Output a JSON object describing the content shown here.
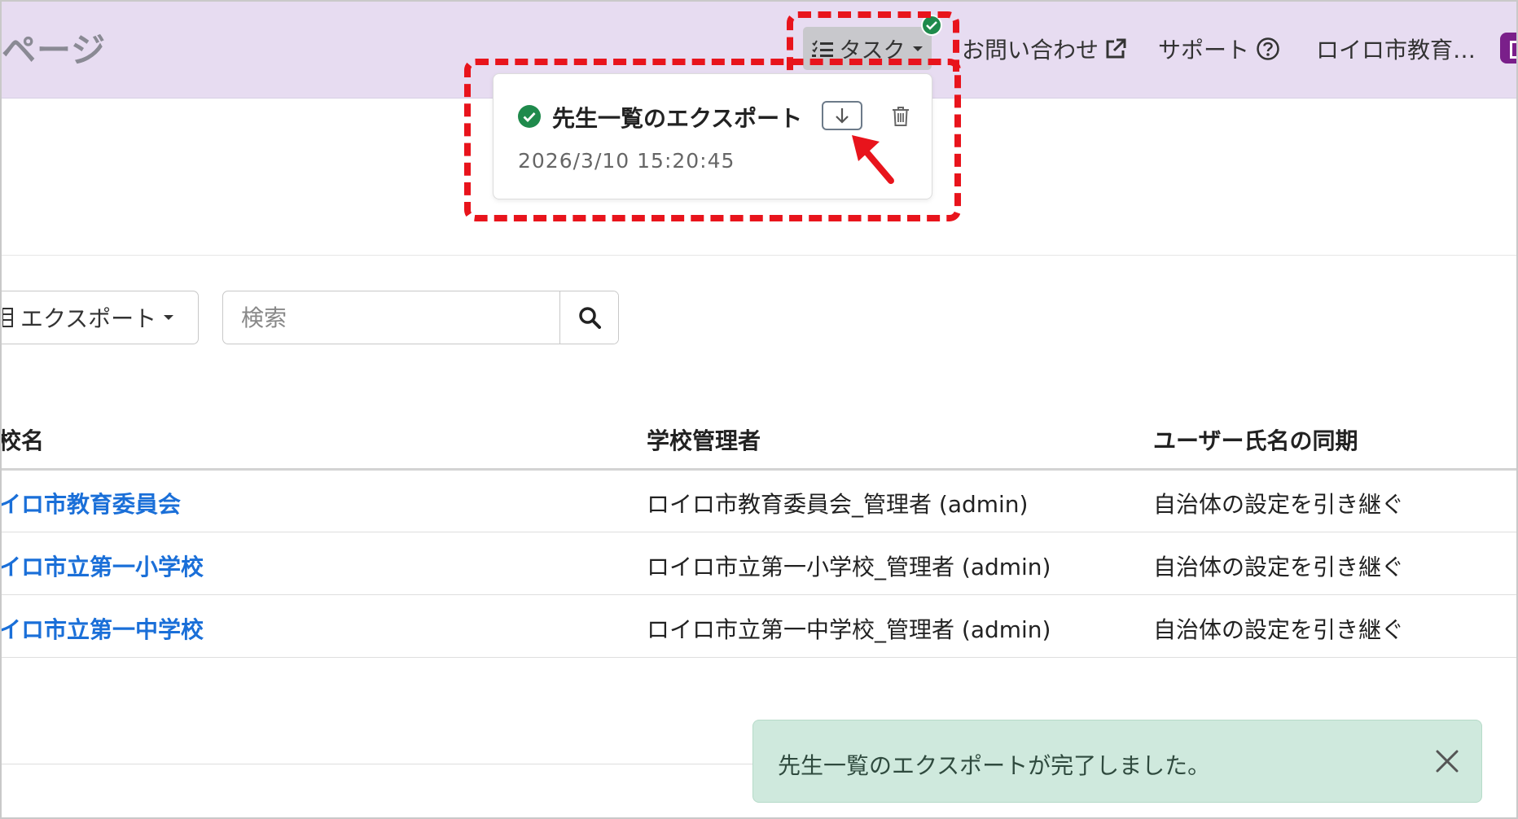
{
  "header": {
    "page_title": "ページ",
    "task_button_label": "タスク",
    "contact_label": "お問い合わせ",
    "support_label": "サポート",
    "org_label": "ロイロ市教育…"
  },
  "task_popover": {
    "title": "先生一覧のエクスポート",
    "timestamp": "2026/3/10 15:20:45"
  },
  "toolbar": {
    "export_label": "エクスポート",
    "search_placeholder": "検索"
  },
  "table": {
    "headers": [
      "校名",
      "学校管理者",
      "ユーザー氏名の同期"
    ],
    "rows": [
      {
        "name": "イロ市教育委員会",
        "admin": "ロイロ市教育委員会_管理者 (admin)",
        "sync": "自治体の設定を引き継ぐ"
      },
      {
        "name": "イロ市立第一小学校",
        "admin": "ロイロ市立第一小学校_管理者 (admin)",
        "sync": "自治体の設定を引き継ぐ"
      },
      {
        "name": "イロ市立第一中学校",
        "admin": "ロイロ市立第一中学校_管理者 (admin)",
        "sync": "自治体の設定を引き継ぐ"
      }
    ]
  },
  "toast": {
    "message": "先生一覧のエクスポートが完了しました。"
  },
  "colors": {
    "header_bg": "#e7dcf1",
    "highlight_red": "#e8141c",
    "success_green": "#1f8a4c",
    "link_blue": "#1a6fd8",
    "toast_bg": "#cfe9dd"
  }
}
